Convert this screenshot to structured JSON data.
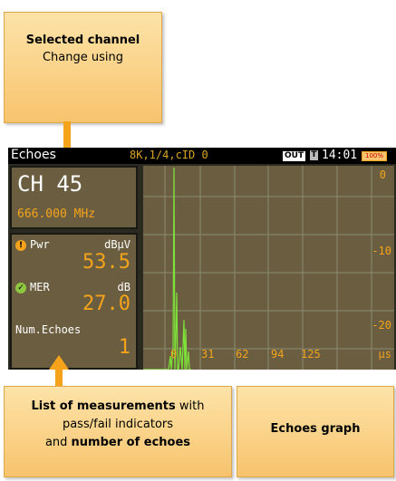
{
  "callouts": {
    "channel": {
      "title": "Selected channel",
      "text": "Change using"
    },
    "measurements": {
      "line1_bold": "List of measurements",
      "line1_rest": " with",
      "line2": "pass/fail indicators",
      "line3_pre": "and ",
      "line3_bold": "number of echoes"
    },
    "graph": {
      "title": "Echoes graph"
    }
  },
  "screen": {
    "title": "Echoes",
    "mode": "8K,1/4,cID 0",
    "out_badge": "OUT",
    "t_badge": "T",
    "clock": "14:01",
    "battery": "100%",
    "channel": {
      "label": "CH 45",
      "frequency": "666.000 MHz"
    },
    "measurements": {
      "pwr_label": "Pwr",
      "pwr_unit": "dBµV",
      "pwr_value": "53.5",
      "pwr_status": "warning",
      "mer_label": "MER",
      "mer_unit": "dB",
      "mer_value": "27.0",
      "mer_status": "pass",
      "echoes_label": "Num.Echoes",
      "echoes_value": "1"
    },
    "graph": {
      "y_labels": [
        "0",
        "-10",
        "-20"
      ],
      "x_labels": [
        "0",
        "31",
        "62",
        "94",
        "125"
      ],
      "x_unit": "µs",
      "trace_color": "#7ee23a"
    }
  }
}
